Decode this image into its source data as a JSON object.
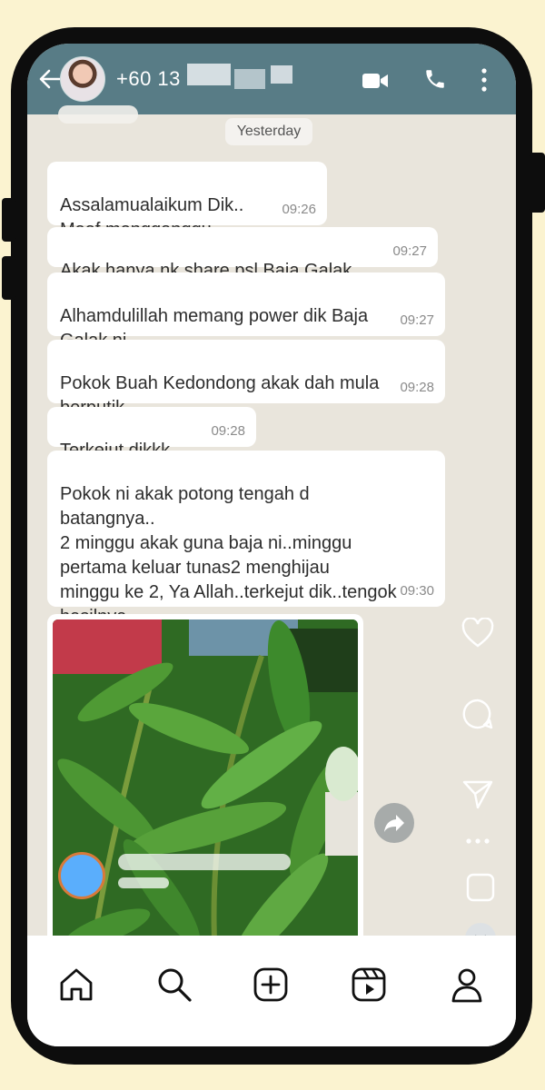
{
  "header": {
    "contact_name": "+60 13"
  },
  "date_chip": "Yesterday",
  "messages": [
    {
      "text": "Assalamualaikum Dik..\nMaaf mengganggu..",
      "time": "09:26"
    },
    {
      "text": "Akak hanya nk share psl Baja Galak",
      "time": "09:27"
    },
    {
      "text": "Alhamdulillah memang power dik Baja\nGalak ni..",
      "time": "09:27"
    },
    {
      "text": "Pokok Buah Kedondong akak dah mula\nberputik..",
      "time": "09:28"
    },
    {
      "text": "Terkejut dikkk..",
      "time": "09:28"
    },
    {
      "text": "Pokok ni akak potong tengah d\nbatangnya..\n2 minggu akak guna baja ni..minggu\npertama keluar tunas2 menghijau\nminggu ke 2, Ya Allah..terkejut dik..tengok\nhasilnya..",
      "time": "09:30"
    }
  ],
  "icons": {
    "header": [
      "back-arrow-icon",
      "video-call-icon",
      "phone-icon",
      "more-vertical-icon"
    ],
    "ig_side": [
      "heart-icon",
      "comment-icon",
      "send-icon",
      "more-horizontal-icon",
      "save-icon",
      "chevron-down-icon"
    ],
    "nav": [
      "home-icon",
      "search-icon",
      "create-icon",
      "reels-icon",
      "profile-icon"
    ]
  },
  "colors": {
    "background": "#fbf3d0",
    "header": "#587c86",
    "chat_bg": "#e9e5dc",
    "bubble": "#ffffff",
    "avatar_blue": "#5aaefc"
  }
}
